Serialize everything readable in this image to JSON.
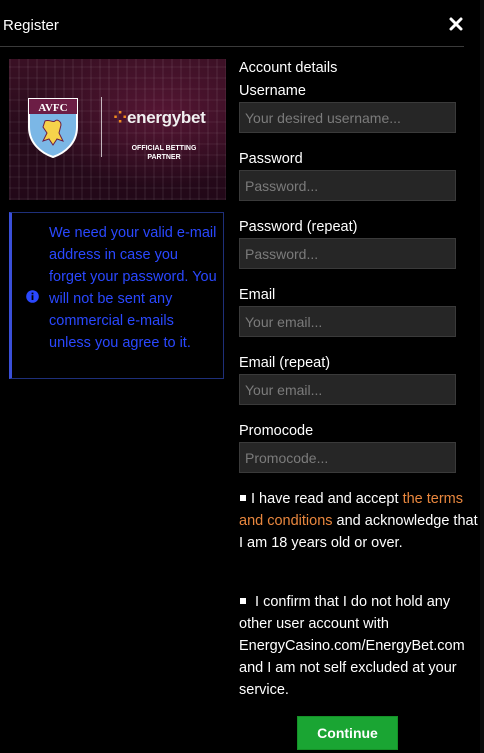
{
  "header": {
    "title": "Register"
  },
  "banner": {
    "club_abbr": "AVFC",
    "brand": "energybet",
    "partner_line1": "OFFICIAL BETTING",
    "partner_line2": "PARTNER"
  },
  "notice": {
    "icon": "info-icon",
    "text": "We need your valid e-mail address in case you forget your password. You will not be sent any commercial e-mails unless you agree to it."
  },
  "form": {
    "section_title": "Account details",
    "fields": [
      {
        "label": "Username",
        "placeholder": "Your desired username...",
        "value": ""
      },
      {
        "label": "Password",
        "placeholder": "Password...",
        "value": ""
      },
      {
        "label": "Password (repeat)",
        "placeholder": "Password...",
        "value": ""
      },
      {
        "label": "Email",
        "placeholder": "Your email...",
        "value": ""
      },
      {
        "label": "Email (repeat)",
        "placeholder": "Your email...",
        "value": ""
      },
      {
        "label": "Promocode",
        "placeholder": "Promocode...",
        "value": ""
      }
    ],
    "terms": {
      "before": "I have read and accept ",
      "link": "the terms and conditions",
      "after": " and acknowledge that I am 18 years old or over."
    },
    "account_confirm": "I confirm that I do not hold any other user account with EnergyCasino.com/EnergyBet.com and I am not self excluded at your service."
  },
  "actions": {
    "continue_label": "Continue"
  },
  "colors": {
    "accent_link": "#e9873e",
    "notice_text": "#2a48ff",
    "continue_bg": "#1aa533",
    "input_bg": "#262626"
  }
}
